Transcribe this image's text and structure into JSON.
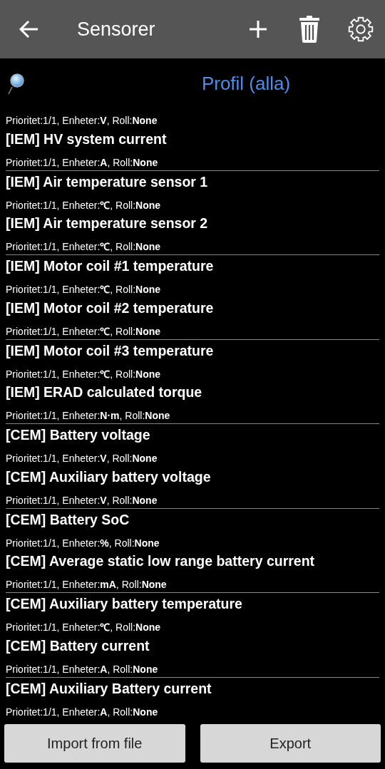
{
  "app_bar": {
    "title": "Sensorer"
  },
  "filter": {
    "profile": "Profil (alla)"
  },
  "groups": [
    {
      "sensors": [
        {
          "meta": "Prioritet:1/1, Enheter:**V**, Roll:**None**"
        },
        {
          "title": "[IEM] HV system current",
          "meta": "Prioritet:1/1, Enheter:**A**, Roll:**None**"
        }
      ]
    },
    {
      "sensors": [
        {
          "title": "[IEM] Air temperature sensor 1",
          "meta": "Prioritet:1/1, Enheter:**℃**, Roll:**None**"
        },
        {
          "title": "[IEM] Air temperature sensor 2",
          "meta": "Prioritet:1/1, Enheter:**℃**, Roll:**None**"
        }
      ]
    },
    {
      "sensors": [
        {
          "title": "[IEM] Motor coil #1 temperature",
          "meta": "Prioritet:1/1, Enheter:**℃**, Roll:**None**"
        },
        {
          "title": "[IEM] Motor coil #2 temperature",
          "meta": "Prioritet:1/1, Enheter:**℃**, Roll:**None**"
        }
      ]
    },
    {
      "sensors": [
        {
          "title": "[IEM] Motor coil #3 temperature",
          "meta": "Prioritet:1/1, Enheter:**℃**, Roll:**None**"
        },
        {
          "title": "[IEM] ERAD calculated torque",
          "meta": "Prioritet:1/1, Enheter:**N·m**, Roll:**None**"
        }
      ]
    },
    {
      "sensors": [
        {
          "title": "[CEM] Battery voltage",
          "meta": "Prioritet:1/1, Enheter:**V**, Roll:**None**"
        },
        {
          "title": "[CEM] Auxiliary battery voltage",
          "meta": "Prioritet:1/1, Enheter:**V**, Roll:**None**"
        }
      ]
    },
    {
      "sensors": [
        {
          "title": "[CEM] Battery SoC",
          "meta": "Prioritet:1/1, Enheter:**%**, Roll:**None**"
        },
        {
          "title": "[CEM] Average static low range battery current",
          "meta": "Prioritet:1/1, Enheter:**mA**, Roll:**None**"
        }
      ]
    },
    {
      "sensors": [
        {
          "title": "[CEM] Auxiliary battery temperature",
          "meta": "Prioritet:1/1, Enheter:**℃**, Roll:**None**"
        },
        {
          "title": "[CEM] Battery current",
          "meta": "Prioritet:1/1, Enheter:**A**, Roll:**None**"
        }
      ]
    },
    {
      "sensors": [
        {
          "title": "[CEM] Auxiliary Battery current",
          "meta": "Prioritet:1/1, Enheter:**A**, Roll:**None**"
        }
      ]
    }
  ],
  "buttons": [
    "Import from file",
    "Export"
  ]
}
